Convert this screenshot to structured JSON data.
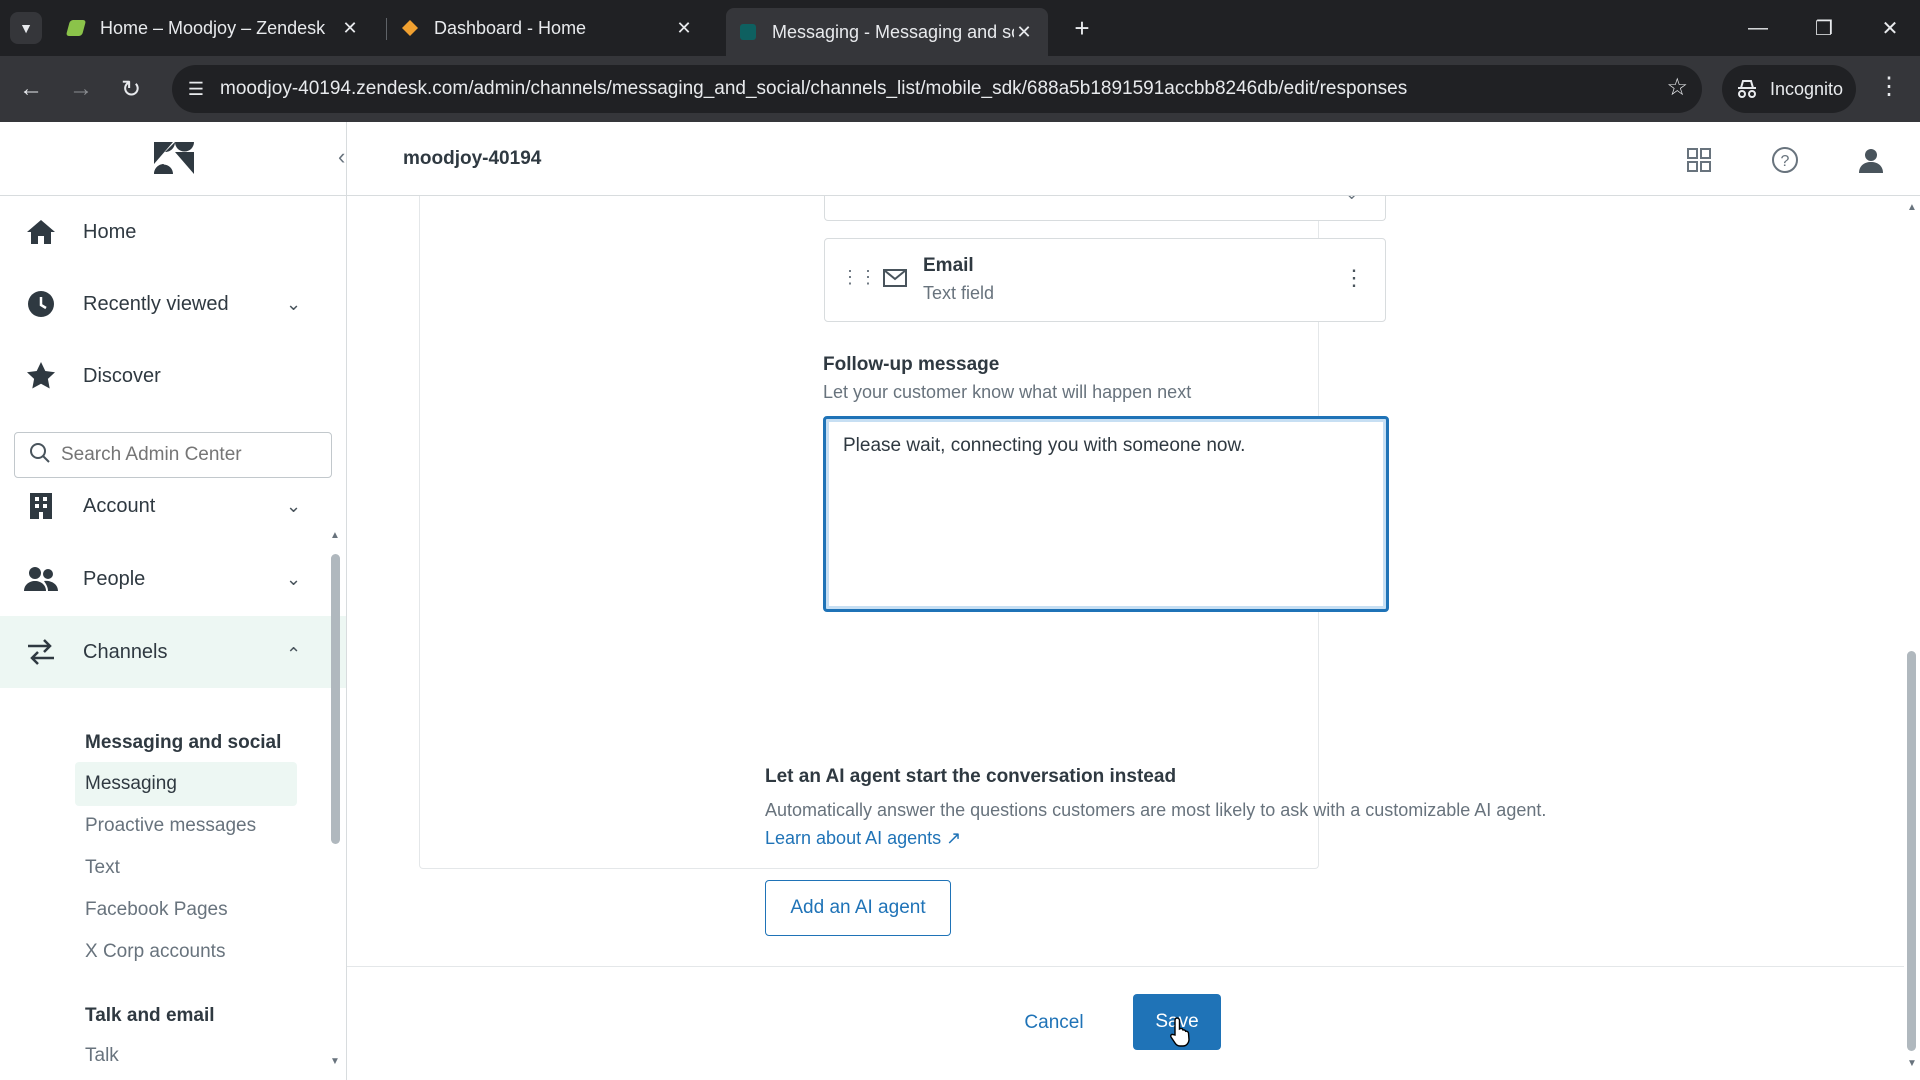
{
  "browser": {
    "tabs": [
      {
        "title": "Home – Moodjoy – Zendesk",
        "favicon_color": "#8bc34a"
      },
      {
        "title": "Dashboard - Home",
        "favicon_color": "#f0a030"
      },
      {
        "title": "Messaging - Messaging and so",
        "favicon_color": "#03363d"
      }
    ],
    "url": "moodjoy-40194.zendesk.com/admin/channels/messaging_and_social/channels_list/mobile_sdk/688a5b1891591accbb8246db/edit/responses",
    "incognito_label": "Incognito"
  },
  "header": {
    "account": "moodjoy-40194"
  },
  "sidebar": {
    "top_items": [
      {
        "label": "Home",
        "icon": "home-icon"
      },
      {
        "label": "Recently viewed",
        "icon": "clock-icon"
      },
      {
        "label": "Discover",
        "icon": "star-icon"
      }
    ],
    "search_placeholder": "Search Admin Center",
    "sections": [
      {
        "label": "Account",
        "icon": "building-icon"
      },
      {
        "label": "People",
        "icon": "people-icon"
      },
      {
        "label": "Channels",
        "icon": "arrows-icon"
      }
    ],
    "groups": [
      {
        "heading": "Messaging and social",
        "items": [
          "Messaging",
          "Proactive messages",
          "Text",
          "Facebook Pages",
          "X Corp accounts"
        ]
      },
      {
        "heading": "Talk and email",
        "items": [
          "Talk"
        ]
      }
    ],
    "active_item": "Messaging"
  },
  "form": {
    "field": {
      "name": "Email",
      "type": "Text field"
    },
    "followup_label": "Follow-up message",
    "followup_hint": "Let your customer know what will happen next",
    "followup_value": "Please wait, connecting you with someone now.",
    "ai_title": "Let an AI agent start the conversation instead",
    "ai_desc": "Automatically answer the questions customers are most likely to ask with a customizable AI agent.",
    "ai_link": "Learn about AI agents",
    "ai_button": "Add an AI agent",
    "cancel": "Cancel",
    "save": "Save"
  },
  "colors": {
    "brand_blue": "#1f73b7",
    "active_bg": "#edf7f3"
  }
}
